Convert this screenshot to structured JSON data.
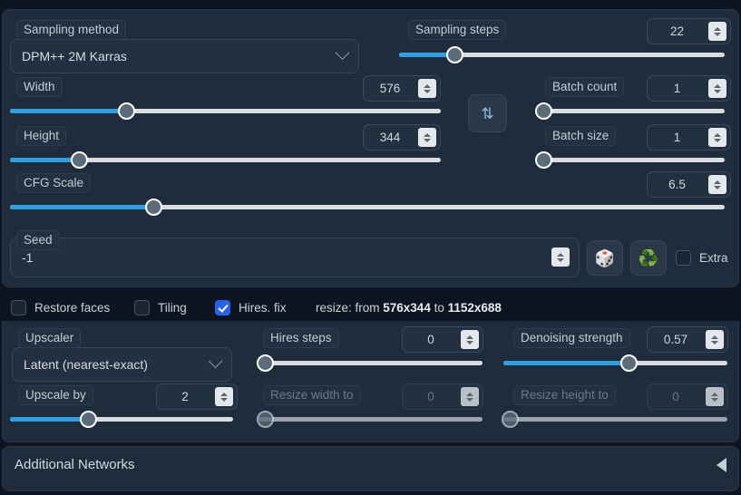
{
  "sampling": {
    "method_label": "Sampling method",
    "method_value": "DPM++ 2M Karras",
    "steps_label": "Sampling steps",
    "steps_value": "22"
  },
  "dimensions": {
    "width_label": "Width",
    "width_value": "576",
    "height_label": "Height",
    "height_value": "344",
    "swap_icon": "swap-vertical-icon",
    "swap_glyph": "⇅"
  },
  "batch": {
    "count_label": "Batch count",
    "count_value": "1",
    "size_label": "Batch size",
    "size_value": "1"
  },
  "cfg": {
    "label": "CFG Scale",
    "value": "6.5"
  },
  "seed": {
    "label": "Seed",
    "value": "-1",
    "random_icon": "dice-icon",
    "random_glyph": "🎲",
    "reuse_icon": "recycle-icon",
    "reuse_glyph": "♻️",
    "extra_label": "Extra",
    "extra_checked": false
  },
  "options": {
    "restore_faces_label": "Restore faces",
    "restore_faces_checked": false,
    "tiling_label": "Tiling",
    "tiling_checked": false,
    "hires_fix_label": "Hires. fix",
    "hires_fix_checked": true,
    "resize_prefix": "resize: from ",
    "resize_from": "576x344",
    "resize_middle": " to ",
    "resize_to": "1152x688"
  },
  "hires": {
    "upscaler_label": "Upscaler",
    "upscaler_value": "Latent (nearest-exact)",
    "hires_steps_label": "Hires steps",
    "hires_steps_value": "0",
    "denoising_label": "Denoising strength",
    "denoising_value": "0.57",
    "upscale_by_label": "Upscale by",
    "upscale_by_value": "2",
    "resize_width_label": "Resize width to",
    "resize_width_value": "0",
    "resize_height_label": "Resize height to",
    "resize_height_value": "0"
  },
  "additional_networks": {
    "title": "Additional Networks",
    "arrow_icon": "triangle-left-icon"
  },
  "colors": {
    "accent": "#2f9fe0",
    "panel": "#1f2c3c",
    "page": "#0e1520",
    "checkbox_checked": "#2563eb"
  }
}
